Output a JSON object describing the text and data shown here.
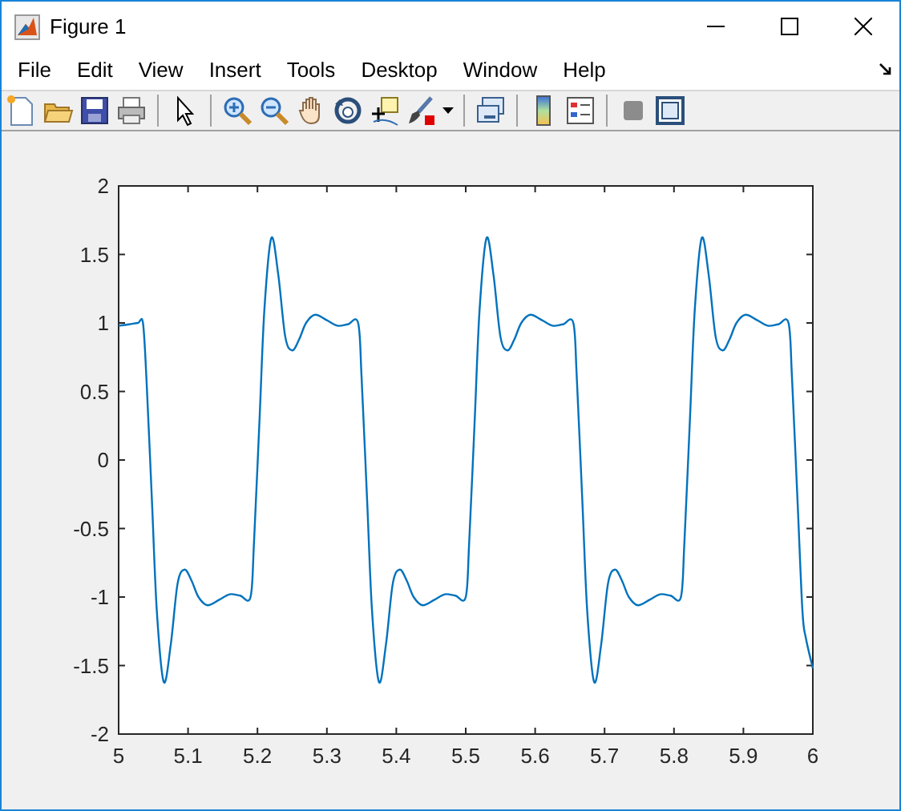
{
  "window": {
    "title": "Figure 1"
  },
  "menu": [
    {
      "label": "File"
    },
    {
      "label": "Edit"
    },
    {
      "label": "View"
    },
    {
      "label": "Insert"
    },
    {
      "label": "Tools"
    },
    {
      "label": "Desktop"
    },
    {
      "label": "Window"
    },
    {
      "label": "Help"
    }
  ],
  "toolbar": [
    {
      "kind": "new"
    },
    {
      "kind": "open"
    },
    {
      "kind": "save"
    },
    {
      "kind": "print"
    },
    {
      "kind": "sep"
    },
    {
      "kind": "pointer"
    },
    {
      "kind": "sep"
    },
    {
      "kind": "zoomin"
    },
    {
      "kind": "zoomout"
    },
    {
      "kind": "pan"
    },
    {
      "kind": "rotate"
    },
    {
      "kind": "cursor"
    },
    {
      "kind": "brush"
    },
    {
      "kind": "sep"
    },
    {
      "kind": "link"
    },
    {
      "kind": "sep"
    },
    {
      "kind": "colorbar"
    },
    {
      "kind": "legend"
    },
    {
      "kind": "sep"
    },
    {
      "kind": "hide"
    },
    {
      "kind": "dock"
    }
  ],
  "figure": {
    "chart_data": {
      "type": "line",
      "xlim": [
        5,
        6
      ],
      "ylim": [
        -2,
        2
      ],
      "xticks": [
        5,
        5.1,
        5.2,
        5.3,
        5.4,
        5.5,
        5.6,
        5.7,
        5.8,
        5.9,
        6
      ],
      "yticks": [
        -2,
        -1.5,
        -1,
        -0.5,
        0,
        0.5,
        1,
        1.5,
        2
      ],
      "x": [
        5.0,
        5.015,
        5.028,
        5.035,
        5.04,
        5.048,
        5.055,
        5.065,
        5.075,
        5.085,
        5.095,
        5.105,
        5.115,
        5.128,
        5.145,
        5.16,
        5.175,
        5.19,
        5.195,
        5.203,
        5.21,
        5.22,
        5.23,
        5.24,
        5.25,
        5.26,
        5.27,
        5.283,
        5.3,
        5.315,
        5.33,
        5.345,
        5.35,
        5.358,
        5.365,
        5.375,
        5.385,
        5.395,
        5.405,
        5.415,
        5.425,
        5.438,
        5.455,
        5.47,
        5.485,
        5.5,
        5.505,
        5.513,
        5.52,
        5.53,
        5.54,
        5.55,
        5.56,
        5.57,
        5.58,
        5.593,
        5.61,
        5.625,
        5.64,
        5.655,
        5.66,
        5.668,
        5.675,
        5.685,
        5.695,
        5.705,
        5.715,
        5.725,
        5.735,
        5.748,
        5.765,
        5.78,
        5.795,
        5.81,
        5.815,
        5.823,
        5.83,
        5.84,
        5.85,
        5.86,
        5.87,
        5.88,
        5.89,
        5.903,
        5.92,
        5.935,
        5.95,
        5.965,
        5.97,
        5.978,
        5.985,
        5.99,
        6.0
      ],
      "series": [
        {
          "color": "#0072bd",
          "values": [
            0.98,
            0.99,
            1.0,
            1.0,
            0.6,
            -0.3,
            -1.1,
            -1.62,
            -1.35,
            -0.9,
            -0.8,
            -0.88,
            -1.0,
            -1.06,
            -1.02,
            -0.98,
            -0.99,
            -1.0,
            -0.6,
            0.3,
            1.1,
            1.62,
            1.35,
            0.9,
            0.8,
            0.88,
            1.0,
            1.06,
            1.02,
            0.98,
            0.99,
            1.0,
            0.6,
            -0.3,
            -1.1,
            -1.62,
            -1.35,
            -0.9,
            -0.8,
            -0.88,
            -1.0,
            -1.06,
            -1.02,
            -0.98,
            -0.99,
            -1.0,
            -0.6,
            0.3,
            1.1,
            1.62,
            1.35,
            0.9,
            0.8,
            0.88,
            1.0,
            1.06,
            1.02,
            0.98,
            0.99,
            1.0,
            0.6,
            -0.3,
            -1.1,
            -1.62,
            -1.35,
            -0.9,
            -0.8,
            -0.88,
            -1.0,
            -1.06,
            -1.02,
            -0.98,
            -0.99,
            -1.0,
            -0.6,
            0.3,
            1.1,
            1.62,
            1.35,
            0.9,
            0.8,
            0.88,
            1.0,
            1.06,
            1.02,
            0.98,
            0.99,
            1.0,
            0.6,
            -0.3,
            -1.1,
            -1.3,
            -1.52
          ]
        }
      ]
    }
  }
}
